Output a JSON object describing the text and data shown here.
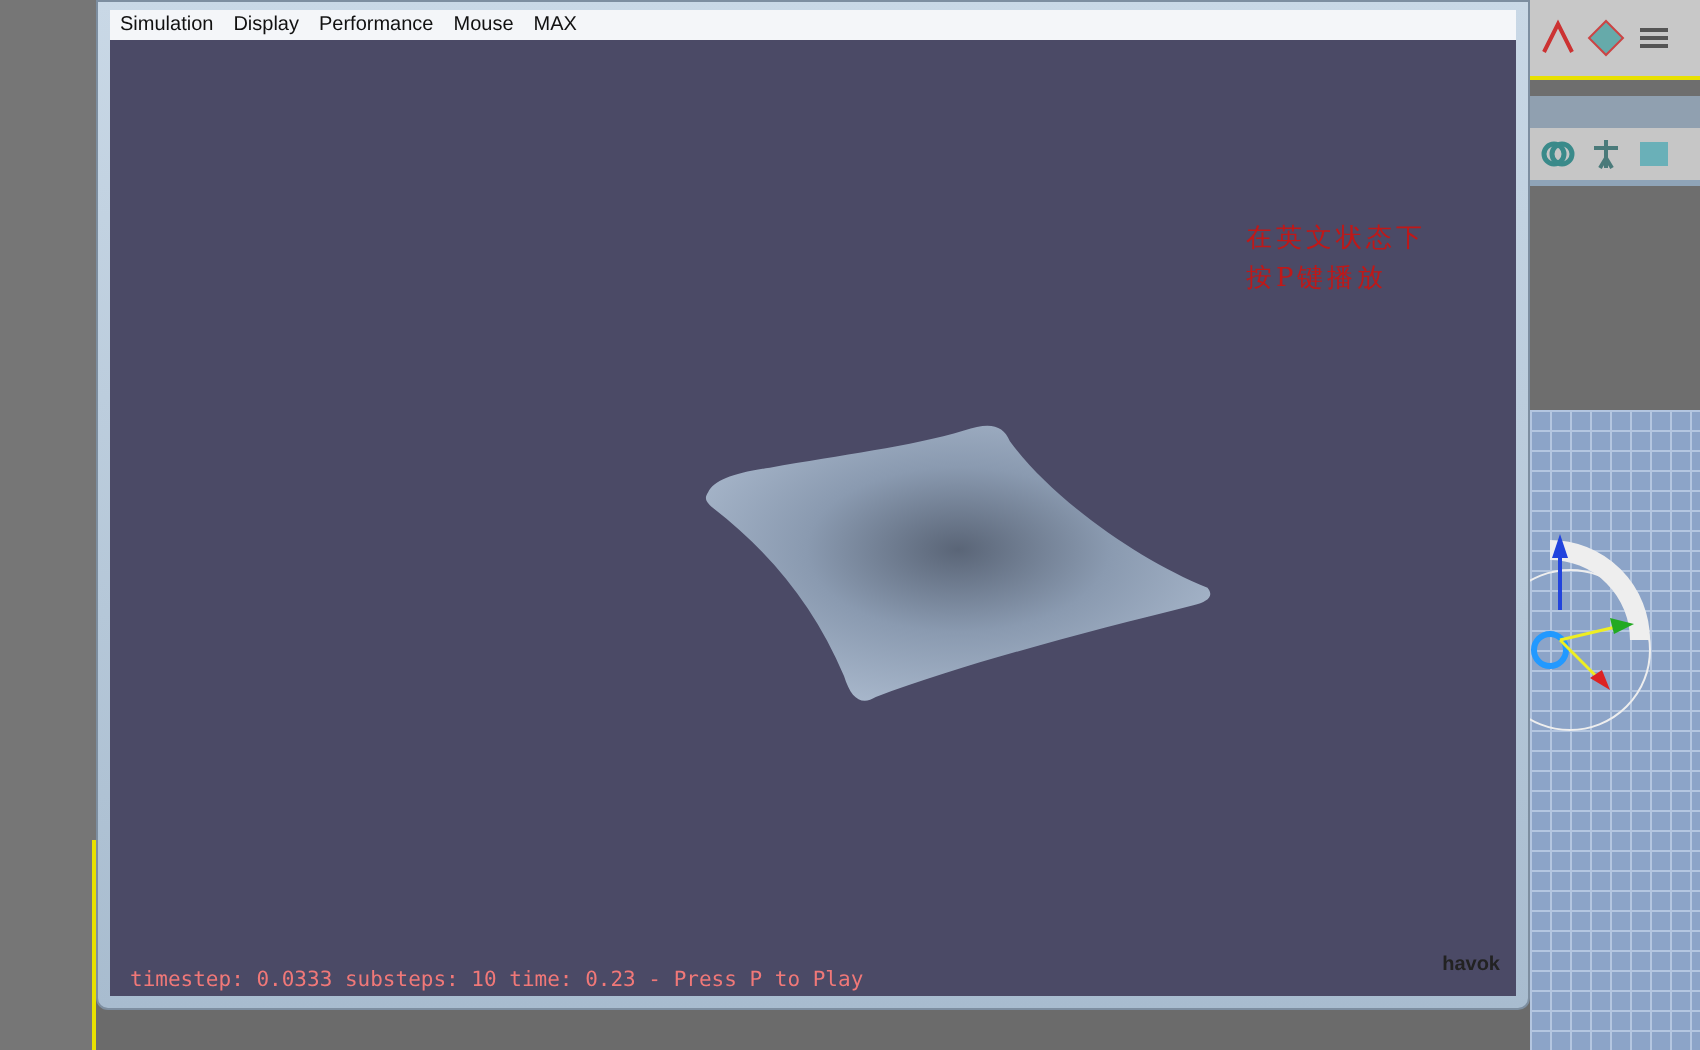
{
  "window": {
    "menu": [
      {
        "label": "Simulation"
      },
      {
        "label": "Display"
      },
      {
        "label": "Performance"
      },
      {
        "label": "Mouse"
      },
      {
        "label": "MAX"
      }
    ]
  },
  "viewport": {
    "annotation": [
      "在英文状态下",
      "按P键播放"
    ],
    "status": "timestep: 0.0333 substeps: 10 time: 0.23 - Press P to Play",
    "logo": "havok"
  }
}
